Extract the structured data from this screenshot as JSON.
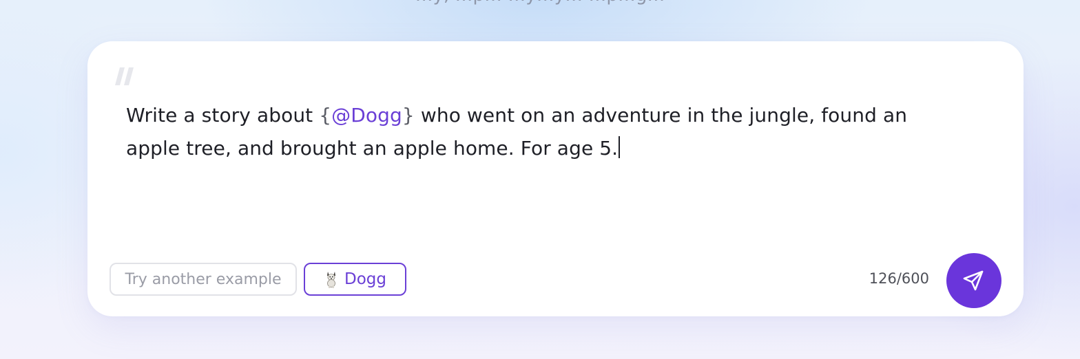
{
  "heading_partial": "…y, …p… …y…y… …p…g…",
  "prompt": {
    "before_mention": "Write a story about ",
    "brace_open": "{",
    "mention": "@Dogg",
    "brace_close": "}",
    "after_mention": " who went on an adventure in the jungle, found an apple tree, and brought an apple home. For age 5."
  },
  "actions": {
    "try_example_label": "Try another example",
    "character_chip_label": "Dogg",
    "character_avatar_icon": "dog-avatar-icon"
  },
  "counter": "126/600",
  "icons": {
    "quote": "quote-mark-icon",
    "send": "send-paper-plane-icon"
  },
  "colors": {
    "accent": "#6a35db",
    "mention": "#6a3fd6",
    "text": "#1e1f26",
    "muted": "#9a9ca6"
  }
}
